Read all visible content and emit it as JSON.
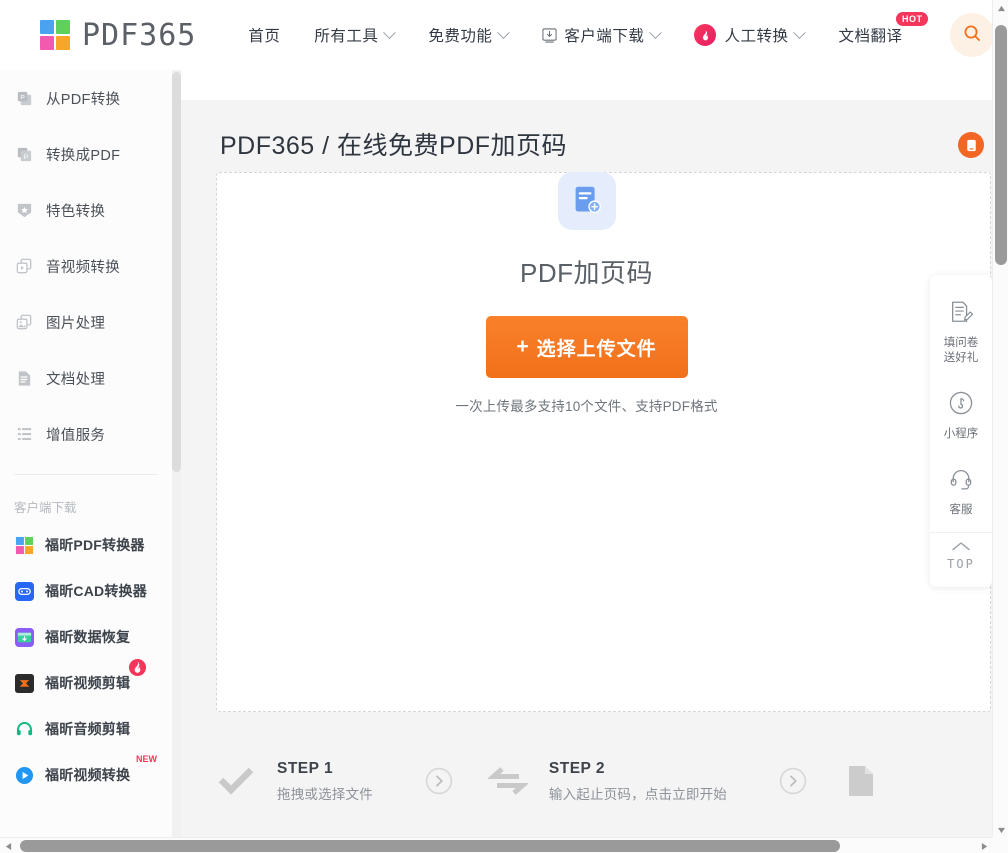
{
  "brand": {
    "name": "PDF365",
    "logo_colors": [
      "#4aa3f0",
      "#5ed05e",
      "#f25ab0",
      "#f7a62a"
    ]
  },
  "header": {
    "nav": [
      {
        "label": "首页",
        "icon": "",
        "caret": false,
        "badge": ""
      },
      {
        "label": "所有工具",
        "icon": "",
        "caret": true,
        "badge": ""
      },
      {
        "label": "免费功能",
        "icon": "",
        "caret": true,
        "badge": ""
      },
      {
        "label": "客户端下载",
        "icon": "download-box-icon",
        "caret": true,
        "badge": ""
      },
      {
        "label": "人工转换",
        "icon": "fire-icon",
        "caret": true,
        "badge": ""
      },
      {
        "label": "文档翻译",
        "icon": "",
        "caret": false,
        "badge": "HOT"
      }
    ],
    "search_icon": "search-icon",
    "vip_icon": "crown-icon"
  },
  "sidebar": {
    "items": [
      {
        "label": "从PDF转换",
        "icon": "pdf-from-icon"
      },
      {
        "label": "转换成PDF",
        "icon": "pdf-to-icon"
      },
      {
        "label": "特色转换",
        "icon": "star-shield-icon"
      },
      {
        "label": "音视频转换",
        "icon": "media-convert-icon"
      },
      {
        "label": "图片处理",
        "icon": "image-process-icon"
      },
      {
        "label": "文档处理",
        "icon": "document-process-icon"
      },
      {
        "label": "增值服务",
        "icon": "value-added-icon"
      }
    ],
    "download_section_title": "客户端下载",
    "downloads": [
      {
        "label": "福昕PDF转换器",
        "icon": "foxit-pdf-icon",
        "badge": ""
      },
      {
        "label": "福昕CAD转换器",
        "icon": "foxit-cad-icon",
        "badge": ""
      },
      {
        "label": "福昕数据恢复",
        "icon": "foxit-recovery-icon",
        "badge": ""
      },
      {
        "label": "福昕视频剪辑",
        "icon": "foxit-video-edit-icon",
        "badge": "FIRE"
      },
      {
        "label": "福昕音频剪辑",
        "icon": "foxit-audio-edit-icon",
        "badge": ""
      },
      {
        "label": "福昕视频转换",
        "icon": "foxit-video-convert-icon",
        "badge": "NEW"
      }
    ]
  },
  "main": {
    "page_title": "PDF365 / 在线免费PDF加页码",
    "corner_icon": "mobile-app-icon",
    "dropzone": {
      "icon": "add-document-icon",
      "title": "PDF加页码",
      "button_label": "选择上传文件",
      "button_plus": "+",
      "hint": "一次上传最多支持10个文件、支持PDF格式"
    },
    "steps": [
      {
        "name": "STEP 1",
        "desc": "拖拽或选择文件",
        "icon": "check-icon"
      },
      {
        "name": "STEP 2",
        "desc": "输入起止页码，点击立即开始",
        "icon": "swap-arrows-icon"
      }
    ]
  },
  "float_panel": {
    "items": [
      {
        "icon": "survey-edit-icon",
        "label": "填问卷\n送好礼",
        "line1": "填问卷",
        "line2": "送好礼"
      },
      {
        "icon": "miniprogram-icon",
        "label": "小程序",
        "line1": "小程序",
        "line2": ""
      },
      {
        "icon": "headset-icon",
        "label": "客服",
        "line1": "客服",
        "line2": ""
      }
    ],
    "top_label": "TOP",
    "top_icon": "chevron-up-icon"
  },
  "colors": {
    "accent_orange": "#f2701a",
    "hot_pink": "#f5365c",
    "page_bg": "#f4f4f4"
  }
}
